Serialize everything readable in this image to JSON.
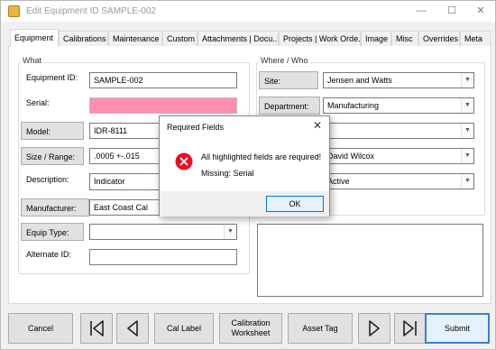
{
  "window": {
    "title": "Edit Equipment ID SAMPLE-002",
    "minimize": "—",
    "maximize": "☐",
    "close": "✕"
  },
  "tabs": [
    "Equipment",
    "Calibrations",
    "Maintenance",
    "Custom",
    "Attachments | Docu...",
    "Projects | Work Orde...",
    "Image",
    "Misc",
    "Overrides",
    "Meta"
  ],
  "what": {
    "group_label": "What",
    "equipment_id_label": "Equipment ID:",
    "equipment_id_value": "SAMPLE-002",
    "serial_label": "Serial:",
    "serial_value": "",
    "model_label": "Model:",
    "model_value": "IDR-8111",
    "size_range_label": "Size / Range:",
    "size_range_value": ".0005 +-.015",
    "description_label": "Description:",
    "description_value": "Indicator",
    "manufacturer_label": "Manufacturer:",
    "manufacturer_value": "East Coast Cal",
    "equip_type_label": "Equip Type:",
    "equip_type_value": "",
    "alternate_id_label": "Alternate ID:",
    "alternate_id_value": ""
  },
  "where": {
    "group_label": "Where / Who",
    "site_label": "Site:",
    "site_value": "Jensen and Watts",
    "department_label": "Department:",
    "department_value": "Manufacturing",
    "row3_value": "",
    "person_value": "David Wilcox",
    "status_value": "Active"
  },
  "buttons": {
    "cancel": "Cancel",
    "cal_label": "Cal Label",
    "calibration_worksheet_line1": "Calibration",
    "calibration_worksheet_line2": "Worksheet",
    "asset_tag": "Asset Tag",
    "submit": "Submit"
  },
  "dialog": {
    "title": "Required Fields",
    "message": "All highlighted fields are required!",
    "missing": "Missing: Serial",
    "ok": "OK",
    "close": "✕"
  },
  "colors": {
    "required_highlight": "#ff8fb0",
    "error_icon": "#e81123",
    "accent": "#0078d7"
  }
}
